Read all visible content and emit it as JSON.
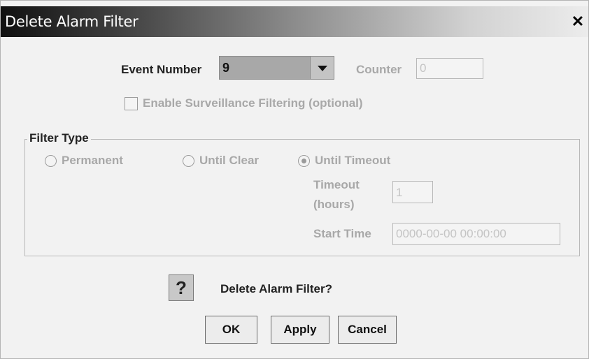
{
  "dialog": {
    "title": "Delete Alarm Filter"
  },
  "event_number": {
    "label": "Event Number",
    "value": "9"
  },
  "counter": {
    "label": "Counter",
    "value": "0"
  },
  "surveillance": {
    "label": "Enable Surveillance Filtering (optional)",
    "checked": false
  },
  "filter_type": {
    "title": "Filter Type",
    "options": [
      {
        "label": "Permanent",
        "selected": false
      },
      {
        "label": "Until Clear",
        "selected": false
      },
      {
        "label": "Until Timeout",
        "selected": true
      }
    ],
    "timeout_label_line1": "Timeout",
    "timeout_label_line2": "(hours)",
    "timeout_value": "1",
    "start_time_label": "Start Time",
    "start_time_value": "0000-00-00 00:00:00"
  },
  "confirm": {
    "icon": "question-icon",
    "icon_glyph": "?",
    "message": "Delete Alarm Filter?"
  },
  "buttons": {
    "ok": "OK",
    "apply": "Apply",
    "cancel": "Cancel"
  }
}
